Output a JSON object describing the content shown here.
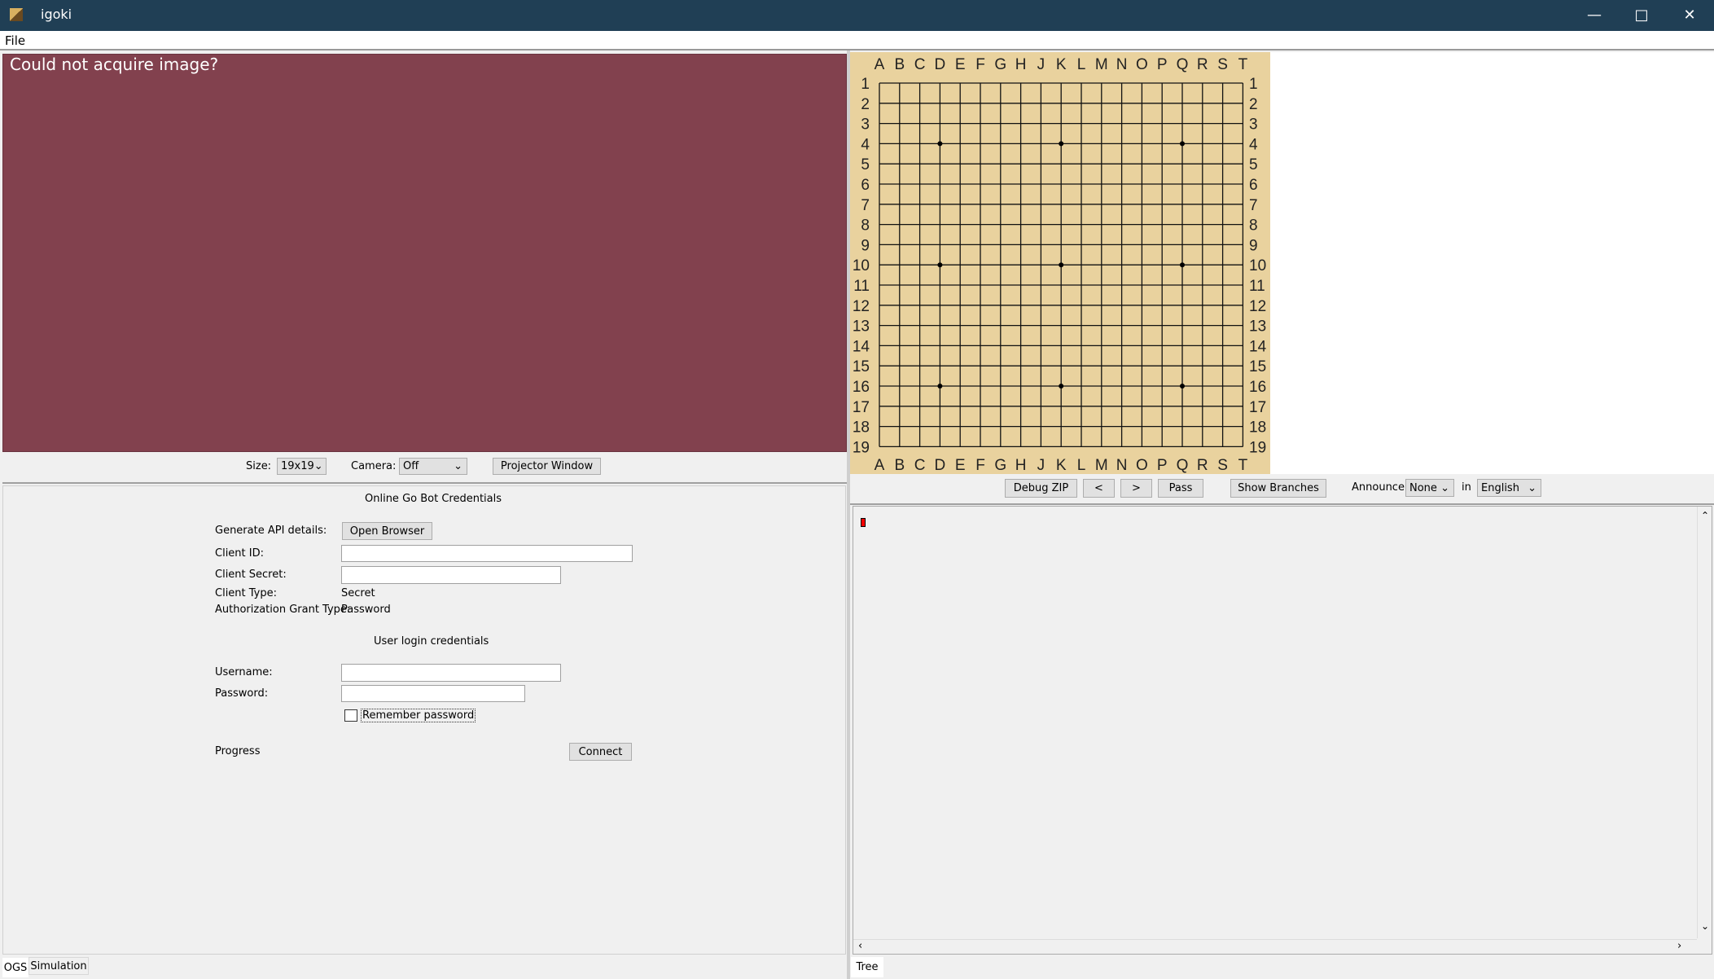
{
  "window": {
    "title": "igoki",
    "minimize_icon": "minimize-icon",
    "maximize_icon": "maximize-icon",
    "close_icon": "close-icon"
  },
  "menu": {
    "file": "File"
  },
  "camera": {
    "message": "Could not acquire image?",
    "background": "#82414e"
  },
  "controls": {
    "size_label": "Size:",
    "size_value": "19x19",
    "camera_label": "Camera:",
    "camera_value": "Off",
    "projector_button": "Projector Window"
  },
  "ogs": {
    "title": "Online Go Bot Credentials",
    "generate_label": "Generate API details:",
    "open_browser": "Open Browser",
    "client_id_label": "Client ID:",
    "client_id_value": "",
    "client_secret_label": "Client Secret:",
    "client_secret_value": "",
    "client_type_label": "Client Type:",
    "client_type_value": "Secret",
    "grant_type_label": "Authorization Grant Type:",
    "grant_type_value": "Password",
    "user_title": "User login credentials",
    "username_label": "Username:",
    "username_value": "",
    "password_label": "Password:",
    "password_value": "",
    "remember_label": "Remember password",
    "remember_checked": false,
    "progress_label": "Progress",
    "connect_button": "Connect"
  },
  "left_tabs": [
    {
      "label": "OGS",
      "active": true
    },
    {
      "label": "Simulation",
      "active": false
    }
  ],
  "board": {
    "size": 19,
    "columns": [
      "A",
      "B",
      "C",
      "D",
      "E",
      "F",
      "G",
      "H",
      "J",
      "K",
      "L",
      "M",
      "N",
      "O",
      "P",
      "Q",
      "R",
      "S",
      "T"
    ],
    "rows": [
      "1",
      "2",
      "3",
      "4",
      "5",
      "6",
      "7",
      "8",
      "9",
      "10",
      "11",
      "12",
      "13",
      "14",
      "15",
      "16",
      "17",
      "18",
      "19"
    ],
    "star_points": [
      "D4",
      "K4",
      "Q4",
      "D10",
      "K10",
      "Q10",
      "D16",
      "K16",
      "Q16"
    ],
    "color": "#e9d29e"
  },
  "toolbar": {
    "debug_zip": "Debug ZIP",
    "prev": "<",
    "next": ">",
    "pass": "Pass",
    "show_branches": "Show Branches",
    "announce_label": "Announce",
    "announce_value": "None",
    "in_label": "in",
    "language_value": "English"
  },
  "right_tabs": [
    {
      "label": "Tree",
      "active": true
    }
  ]
}
